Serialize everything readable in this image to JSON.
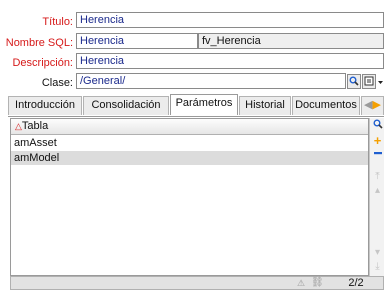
{
  "form": {
    "titulo": {
      "label": "Título:",
      "value": "Herencia"
    },
    "nombre_sql": {
      "label": "Nombre SQL:",
      "value": "Herencia",
      "secondary": "fv_Herencia"
    },
    "descripcion": {
      "label": "Descripción:",
      "value": "Herencia"
    },
    "clase": {
      "label": "Clase:",
      "value": "/General/"
    }
  },
  "tabs": [
    {
      "label": "Introducción",
      "active": false
    },
    {
      "label": "Consolidación",
      "active": false
    },
    {
      "label": "Parámetros",
      "active": true
    },
    {
      "label": "Historial",
      "active": false
    },
    {
      "label": "Documentos",
      "active": false
    }
  ],
  "table": {
    "column": "Tabla",
    "rows": [
      "amAsset",
      "amModel"
    ],
    "selected_row": 1
  },
  "pager": {
    "text": "2/2"
  },
  "colors": {
    "required_label": "#d61a1a",
    "value_text": "#1b2a8c",
    "add_icon": "#f5a000",
    "remove_icon": "#1f5fd0",
    "search_icon": "#1f5fd0"
  }
}
